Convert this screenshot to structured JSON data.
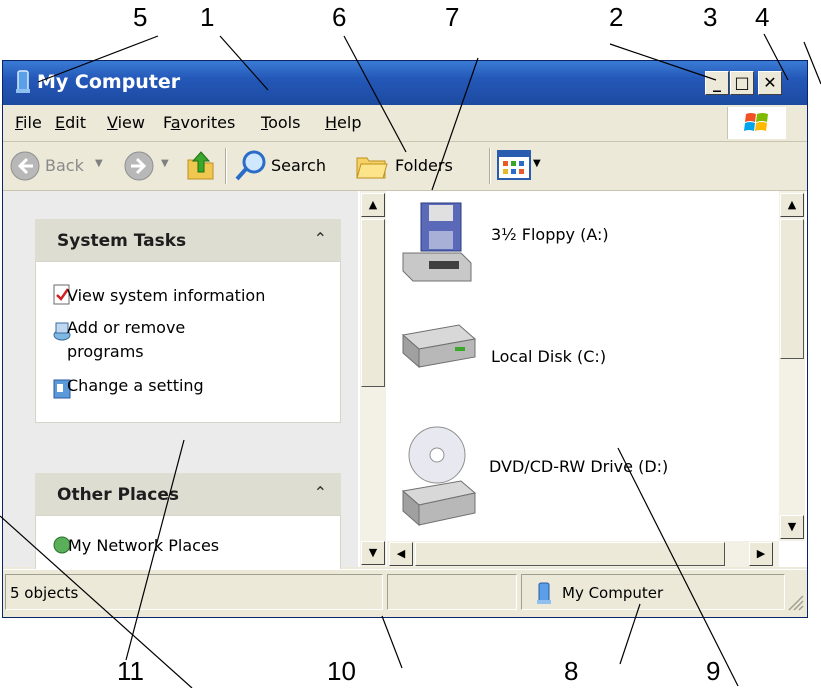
{
  "callouts": {
    "n1": "1",
    "n2": "2",
    "n3": "3",
    "n4": "4",
    "n5": "5",
    "n6": "6",
    "n7": "7",
    "n8": "8",
    "n9": "9",
    "n10": "10",
    "n11": "11"
  },
  "window": {
    "title": "My Computer",
    "controls": {
      "minimize": "_",
      "maximize": "□",
      "close": "✕"
    }
  },
  "menu": {
    "file": {
      "mnemonic": "F",
      "rest": "ile"
    },
    "edit": {
      "mnemonic": "E",
      "rest": "dit"
    },
    "view": {
      "mnemonic": "V",
      "rest": "iew"
    },
    "favorites": {
      "pre": "F",
      "mnemonic": "a",
      "rest": "vorites"
    },
    "tools": {
      "mnemonic": "T",
      "rest": "ools"
    },
    "help": {
      "mnemonic": "H",
      "rest": "elp"
    }
  },
  "toolbar": {
    "back": "Back",
    "search": "Search",
    "folders": "Folders"
  },
  "left_pane": {
    "system_tasks": {
      "title": "System Tasks",
      "items": [
        {
          "label": "View system information",
          "icon": "system-info-icon"
        },
        {
          "label_line1": "Add or remove",
          "label_line2": "programs",
          "icon": "add-remove-programs-icon"
        },
        {
          "label": "Change a setting",
          "icon": "control-panel-icon"
        }
      ]
    },
    "other_places": {
      "title": "Other Places",
      "partial_item": "My Network Places"
    }
  },
  "drives": [
    {
      "label": "3½ Floppy (A:)",
      "icon": "floppy-drive-icon"
    },
    {
      "label": "Local Disk (C:)",
      "icon": "hard-disk-icon"
    },
    {
      "label": "DVD/CD-RW Drive (D:)",
      "icon": "cd-drive-icon"
    }
  ],
  "status": {
    "objects": "5 objects",
    "location": "My Computer"
  },
  "colors": {
    "titlebar": "#2458b8",
    "chrome": "#ece9d8",
    "pane": "#ebebeb"
  }
}
